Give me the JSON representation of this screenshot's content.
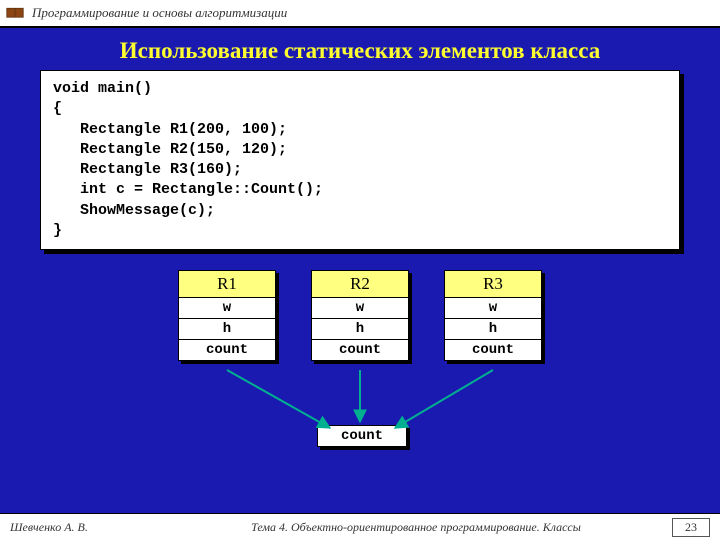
{
  "header": {
    "course": "Программирование и основы алгоритмизации"
  },
  "slide": {
    "title": "Использование статических элементов класса",
    "code": "void main()\n{\n   Rectangle R1(200, 100);\n   Rectangle R2(150, 120);\n   Rectangle R3(160);\n   int c = Rectangle::Count();\n   ShowMessage(c);\n}"
  },
  "objects": [
    {
      "name": "R1",
      "fields": [
        "w",
        "h",
        "count"
      ]
    },
    {
      "name": "R2",
      "fields": [
        "w",
        "h",
        "count"
      ]
    },
    {
      "name": "R3",
      "fields": [
        "w",
        "h",
        "count"
      ]
    }
  ],
  "shared_box": "count",
  "footer": {
    "author": "Шевченко А. В.",
    "topic": "Тема 4. Объектно-ориентированное программирование. Классы",
    "page": "23"
  },
  "colors": {
    "slide_bg": "#1a1ab0",
    "title": "#ffff30",
    "obj_head": "#ffff80",
    "arrow": "#00b090"
  }
}
